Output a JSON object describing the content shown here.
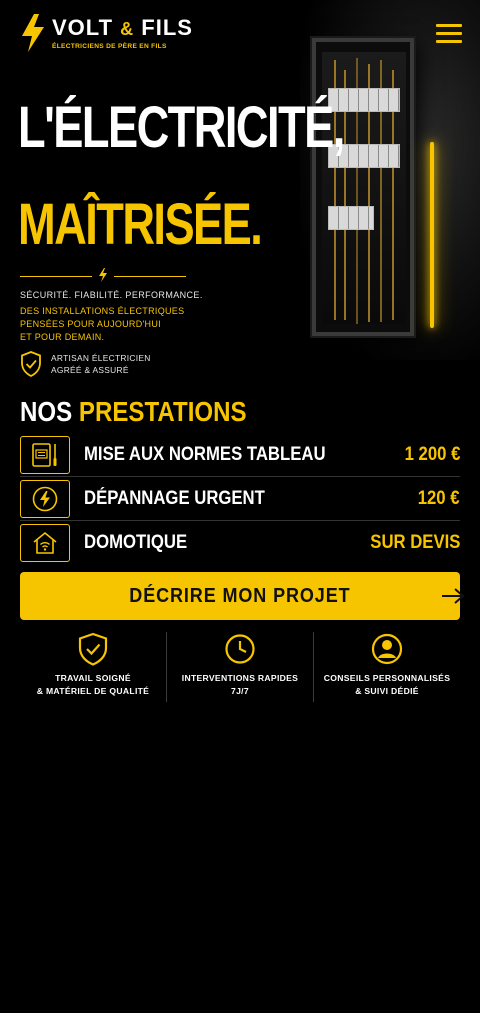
{
  "brand": {
    "name_part1": "VOLT",
    "name_amp": "&",
    "name_part2": "FILS",
    "tagline": "ÉLECTRICIENS DE PÈRE EN FILS"
  },
  "hero": {
    "title_line1": "L'ÉLECTRICITÉ,",
    "title_line2": "MAÎTRISÉE.",
    "tagline": "SÉCURITÉ. FIABILITÉ. PERFORMANCE.",
    "description_lines": [
      "DES INSTALLATIONS ÉLECTRIQUES",
      "PENSÉES POUR AUJOURD'HUI",
      "ET POUR DEMAIN."
    ],
    "certification_lines": [
      "ARTISAN ÉLECTRICIEN",
      "AGRÉÉ & ASSURÉ"
    ]
  },
  "services": {
    "title_part1": "NOS",
    "title_part2": "PRESTATIONS",
    "items": [
      {
        "name": "MISE AUX NORMES TABLEAU",
        "price": "1 200 €",
        "icon": "electrical-panel-icon"
      },
      {
        "name": "DÉPANNAGE URGENT",
        "price": "120 €",
        "icon": "lightning-bolt-icon"
      },
      {
        "name": "DOMOTIQUE",
        "price": "SUR DEVIS",
        "icon": "smart-home-icon"
      }
    ]
  },
  "cta": {
    "label": "DÉCRIRE MON PROJET"
  },
  "features": [
    {
      "lines": [
        "TRAVAIL SOIGNÉ",
        "& MATÉRIEL DE QUALITÉ"
      ],
      "icon": "shield-check-icon"
    },
    {
      "lines": [
        "INTERVENTIONS RAPIDES",
        "7J/7"
      ],
      "icon": "clock-icon"
    },
    {
      "lines": [
        "CONSEILS PERSONNALISÉS",
        "& SUIVI DÉDIÉ"
      ],
      "icon": "user-icon"
    }
  ],
  "colors": {
    "accent": "#f7c500",
    "background": "#000000",
    "text": "#ffffff"
  }
}
